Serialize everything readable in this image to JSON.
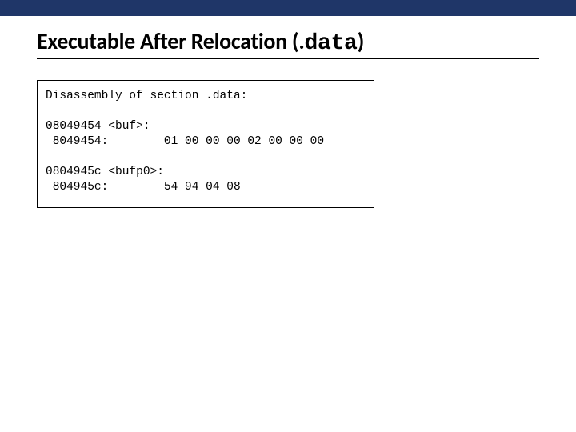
{
  "header": {
    "title_prefix": "Executable After Relocation (.",
    "title_mono": "data",
    "title_suffix": ")"
  },
  "code": {
    "section_header": "Disassembly of section .data:",
    "blocks": [
      {
        "sym_line": "08049454 <buf>:",
        "data_line": " 8049454:        01 00 00 00 02 00 00 00"
      },
      {
        "sym_line": "0804945c <bufp0>:",
        "data_line": " 804945c:        54 94 04 08"
      }
    ]
  }
}
